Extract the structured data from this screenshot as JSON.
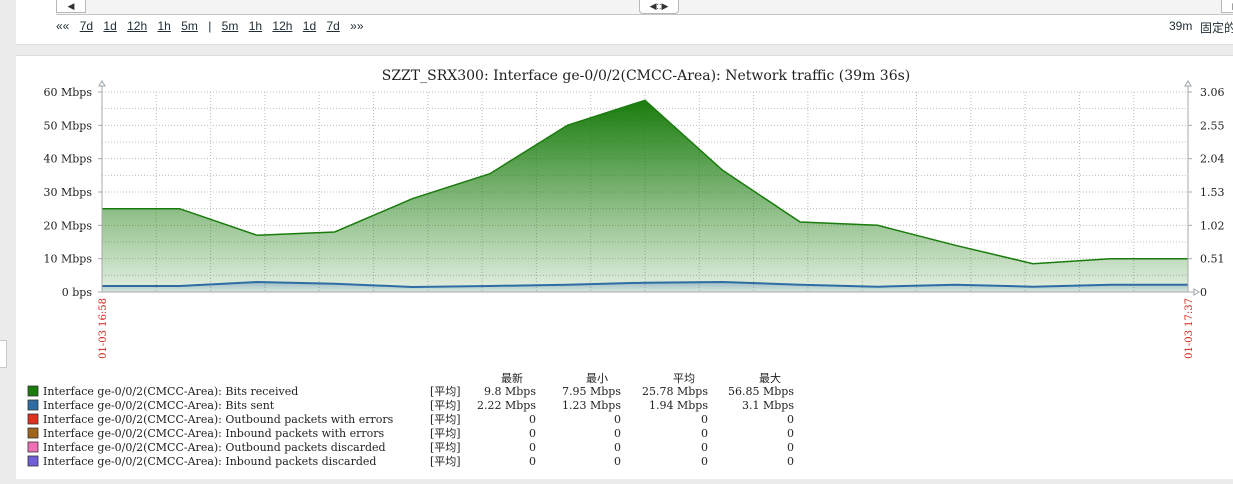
{
  "nav": {
    "left_btn": "◀",
    "handle": "◀::▶",
    "right_btn": "▶",
    "periods_left": [
      "««",
      "7d",
      "1d",
      "12h",
      "1h",
      "5m"
    ],
    "separator": "|",
    "periods_right": [
      "5m",
      "1h",
      "12h",
      "1d",
      "7d",
      "»»"
    ],
    "duration": "39m",
    "fixed_label": "固定的"
  },
  "legend_headers": [
    "最新",
    "最小",
    "平均",
    "最大"
  ],
  "legend": [
    {
      "color": "#1a7c0d",
      "name": "Interface ge-0/0/2(CMCC-Area): Bits received",
      "func": "[平均]",
      "last": "9.8 Mbps",
      "min": "7.95 Mbps",
      "avg": "25.78 Mbps",
      "max": "56.85 Mbps"
    },
    {
      "color": "#2e6da4",
      "name": "Interface ge-0/0/2(CMCC-Area): Bits sent",
      "func": "[平均]",
      "last": "2.22 Mbps",
      "min": "1.23 Mbps",
      "avg": "1.94 Mbps",
      "max": "3.1 Mbps"
    },
    {
      "color": "#e0301e",
      "name": "Interface ge-0/0/2(CMCC-Area): Outbound packets with errors",
      "func": "[平均]",
      "last": "0",
      "min": "0",
      "avg": "0",
      "max": "0"
    },
    {
      "color": "#a0651a",
      "name": "Interface ge-0/0/2(CMCC-Area): Inbound packets with errors",
      "func": "[平均]",
      "last": "0",
      "min": "0",
      "avg": "0",
      "max": "0"
    },
    {
      "color": "#f070b8",
      "name": "Interface ge-0/0/2(CMCC-Area): Outbound packets discarded",
      "func": "[平均]",
      "last": "0",
      "min": "0",
      "avg": "0",
      "max": "0"
    },
    {
      "color": "#6f5fd6",
      "name": "Interface ge-0/0/2(CMCC-Area): Inbound packets discarded",
      "func": "[平均]",
      "last": "0",
      "min": "0",
      "avg": "0",
      "max": "0"
    }
  ],
  "chart_data": {
    "type": "area",
    "title": "SZZT_SRX300: Interface ge-0/0/2(CMCC-Area): Network traffic (39m 36s)",
    "ylim": [
      0,
      60
    ],
    "y_ticks": [
      "60 Mbps",
      "50 Mbps",
      "40 Mbps",
      "30 Mbps",
      "20 Mbps",
      "10 Mbps",
      "0 bps"
    ],
    "y2_ticks": [
      "3.06",
      "2.55",
      "2.04",
      "1.53",
      "1.02",
      "0.51",
      "0"
    ],
    "x_labels": [
      "01-03 16:58",
      "01-03 17:37"
    ],
    "grid": true,
    "n_points": 21,
    "series": [
      {
        "name": "Interface ge-0/0/2(CMCC-Area): Bits received",
        "color": "#1a7c0d",
        "values": [
          25,
          25,
          17,
          18,
          28,
          35.5,
          50,
          57.5,
          36.5,
          21,
          20,
          14,
          8.5,
          10,
          10
        ]
      },
      {
        "name": "Interface ge-0/0/2(CMCC-Area): Bits sent",
        "color": "#2e6da4",
        "values": [
          1.8,
          1.8,
          3,
          2.5,
          1.5,
          1.8,
          2.2,
          2.8,
          3,
          2.2,
          1.6,
          2.2,
          1.6,
          2.2,
          2.2
        ]
      }
    ]
  }
}
